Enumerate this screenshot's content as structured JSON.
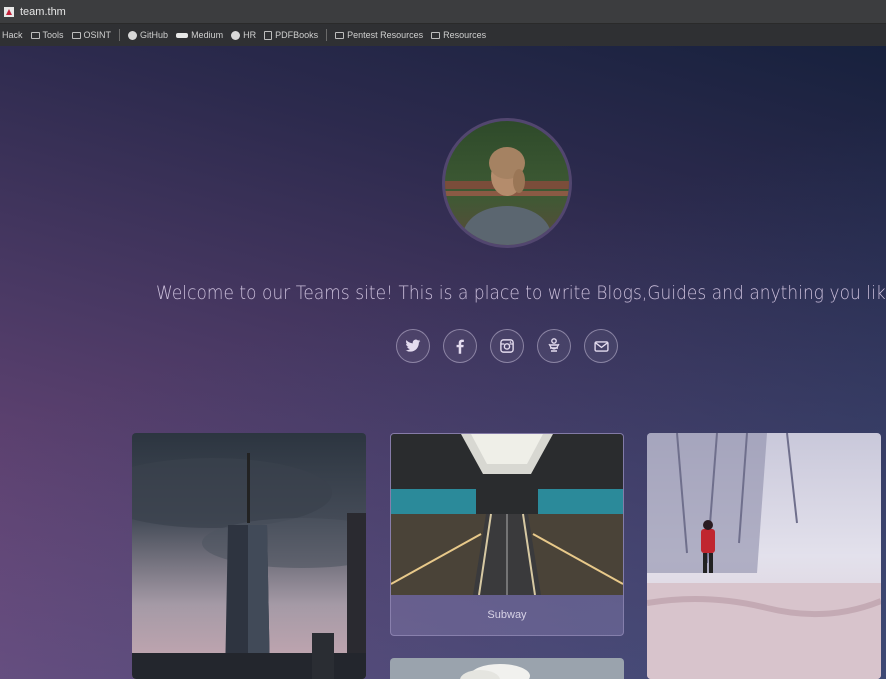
{
  "window": {
    "tab_title": "team.thm"
  },
  "bookmarks": [
    {
      "label": "Hack",
      "icon": "none"
    },
    {
      "label": "Tools",
      "icon": "folder-icon"
    },
    {
      "label": "OSINT",
      "icon": "folder-icon"
    },
    {
      "label": "GitHub",
      "icon": "github-icon"
    },
    {
      "label": "Medium",
      "icon": "medium-icon"
    },
    {
      "label": "HR",
      "icon": "globe-icon"
    },
    {
      "label": "PDFBooks",
      "icon": "book-icon"
    },
    {
      "label": "Pentest Resources",
      "icon": "folder-icon"
    },
    {
      "label": "Resources",
      "icon": "folder-icon"
    }
  ],
  "hero": {
    "welcome_text": "Welcome to our Teams site! This is a place to write Blogs,Guides and anything you like!"
  },
  "social": [
    {
      "name": "twitter",
      "icon": "twitter-icon"
    },
    {
      "name": "facebook",
      "icon": "facebook-icon"
    },
    {
      "name": "instagram",
      "icon": "instagram-icon"
    },
    {
      "name": "other",
      "icon": "social-icon"
    },
    {
      "name": "email",
      "icon": "mail-icon"
    }
  ],
  "gallery": {
    "cards": [
      {
        "caption": ""
      },
      {
        "caption": "Subway"
      },
      {
        "caption": ""
      }
    ]
  },
  "colors": {
    "bg_top": "#17213d",
    "bg_bottom": "#7a4d82",
    "text": "#cbbfdb"
  }
}
